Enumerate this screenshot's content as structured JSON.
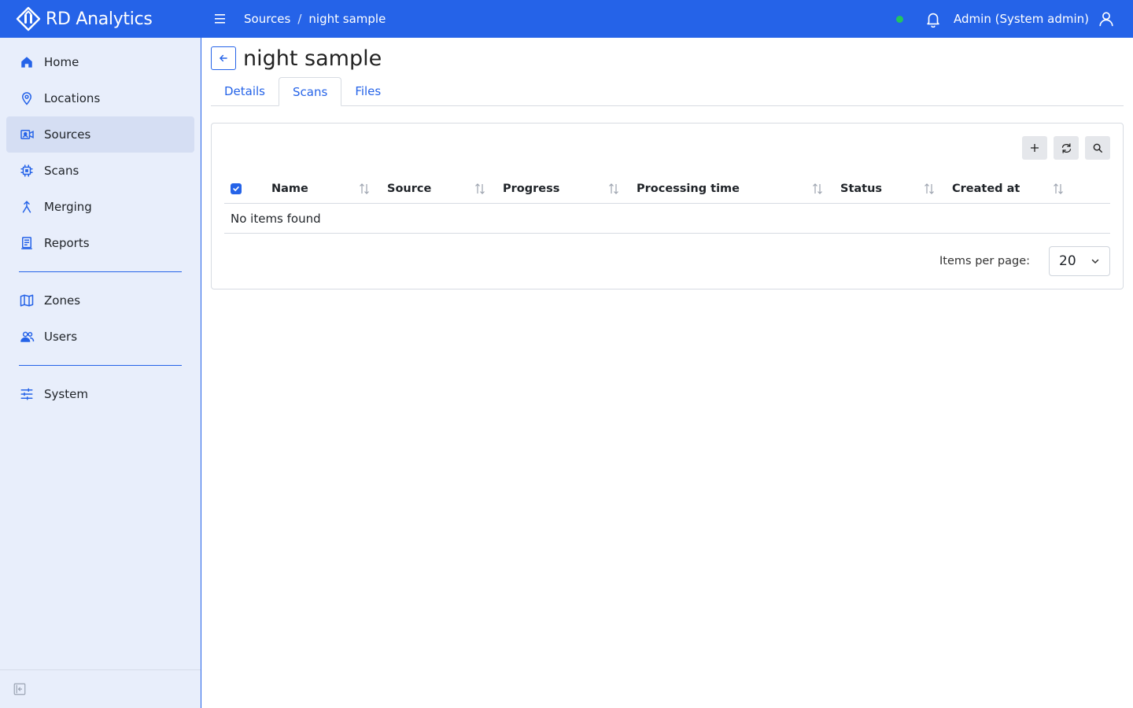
{
  "brand": {
    "name": "RD Analytics"
  },
  "header": {
    "breadcrumb": [
      "Sources",
      "night sample"
    ],
    "breadcrumb_separator": "/",
    "user": "Admin (System admin)",
    "status_color": "#22c55e"
  },
  "sidebar": {
    "items": [
      {
        "label": "Home",
        "icon": "home-icon"
      },
      {
        "label": "Locations",
        "icon": "location-pin-icon"
      },
      {
        "label": "Sources",
        "icon": "camera-icon",
        "active": true
      },
      {
        "label": "Scans",
        "icon": "chip-icon"
      },
      {
        "label": "Merging",
        "icon": "merge-icon"
      },
      {
        "label": "Reports",
        "icon": "report-icon"
      },
      {
        "label": "Zones",
        "icon": "map-icon"
      },
      {
        "label": "Users",
        "icon": "users-icon"
      },
      {
        "label": "System",
        "icon": "sliders-icon"
      }
    ]
  },
  "page": {
    "title": "night sample",
    "tabs": [
      {
        "label": "Details"
      },
      {
        "label": "Scans",
        "active": true
      },
      {
        "label": "Files"
      }
    ]
  },
  "table": {
    "columns": [
      "Name",
      "Source",
      "Progress",
      "Processing time",
      "Status",
      "Created at"
    ],
    "empty_text": "No items found",
    "pager": {
      "label": "Items per page:",
      "value": "20"
    }
  },
  "colors": {
    "accent": "#2563e8",
    "sidebar_bg": "#e8eefb",
    "active_item": "#d5def3"
  }
}
